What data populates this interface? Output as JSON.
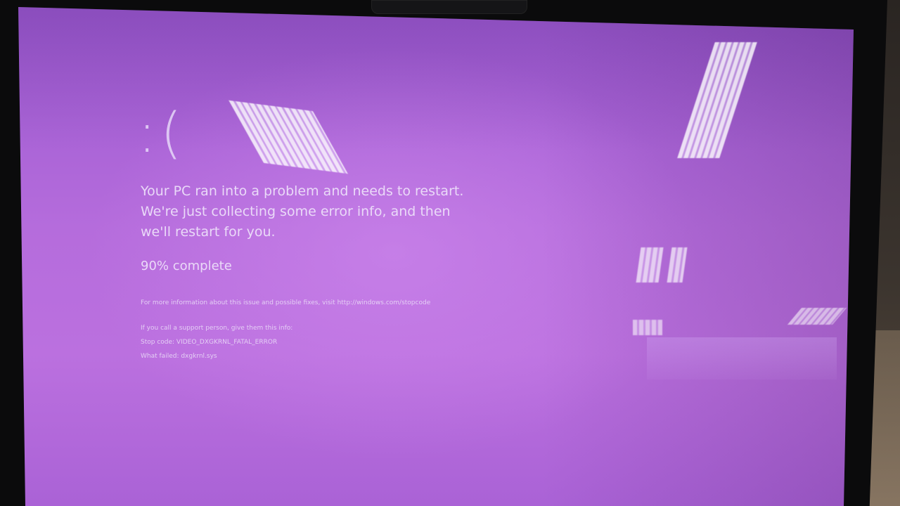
{
  "screen": {
    "face": ":(",
    "headline": "Your PC ran into a problem and needs to restart. We're just collecting some error info, and then we'll restart for you.",
    "progress_text": "90% complete",
    "progress_percent": 90,
    "more_info": "For more information about this issue and possible fixes, visit http://windows.com/stopcode",
    "support_intro": "If you call a support person, give them this info:",
    "stop_code_line": "Stop code: VIDEO_DXGKRNL_FATAL_ERROR",
    "what_failed_line": "What failed: dxgkrnl.sys"
  },
  "colors": {
    "screen_background": "#b56cdc",
    "text": "#eee2fa",
    "bezel": "#0b0b0c"
  }
}
